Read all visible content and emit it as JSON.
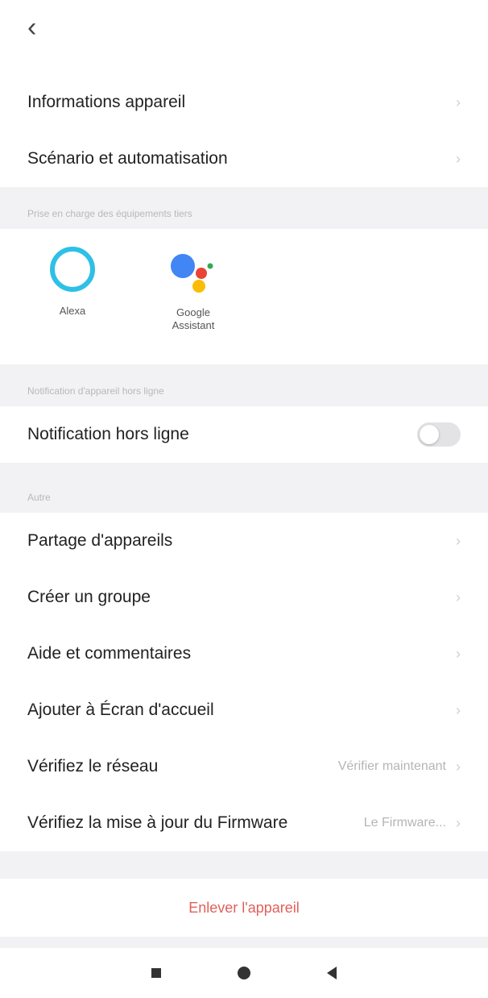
{
  "header": {
    "back_glyph": "‹"
  },
  "menu_top": [
    {
      "label": "Informations appareil"
    },
    {
      "label": "Scénario et automatisation"
    }
  ],
  "third_party": {
    "header": "Prise en charge des équipements tiers",
    "alexa": "Alexa",
    "google_line1": "Google",
    "google_line2": "Assistant"
  },
  "offline": {
    "header": "Notification d'appareil hors ligne",
    "label": "Notification hors ligne",
    "toggle_on": false
  },
  "other": {
    "header": "Autre",
    "items": [
      {
        "label": "Partage d'appareils",
        "value": ""
      },
      {
        "label": "Créer un groupe",
        "value": ""
      },
      {
        "label": "Aide et commentaires",
        "value": ""
      },
      {
        "label": "Ajouter à Écran d'accueil",
        "value": ""
      },
      {
        "label": "Vérifiez le réseau",
        "value": "Vérifier maintenant"
      },
      {
        "label": "Vérifiez la mise à jour du Firmware",
        "value": "Le Firmware..."
      }
    ]
  },
  "remove_label": "Enlever l'appareil",
  "colors": {
    "accent_red": "#e0605a",
    "alexa_blue": "#2ec0e6"
  },
  "icons": [
    "back-arrow-icon",
    "chevron-right-icon",
    "alexa-icon",
    "google-assistant-icon",
    "nav-recents-icon",
    "nav-home-icon",
    "nav-back-icon"
  ]
}
